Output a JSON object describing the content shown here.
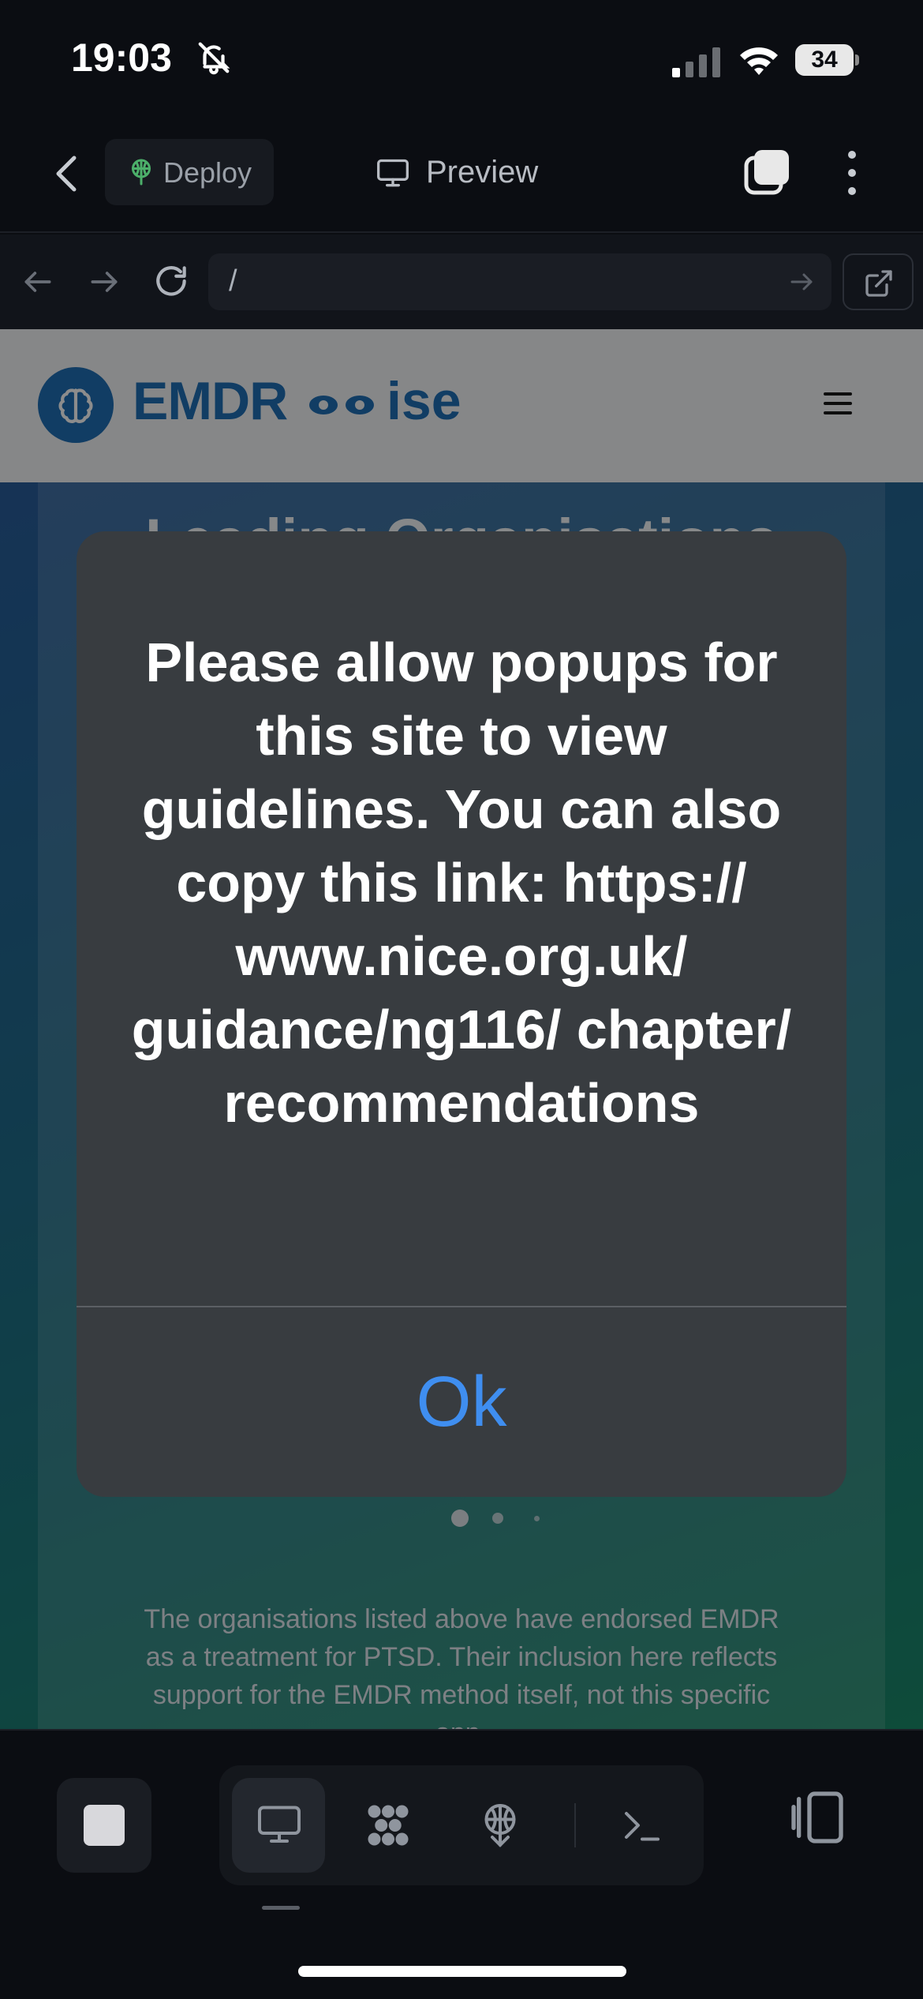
{
  "status_bar": {
    "time": "19:03",
    "battery_percent": "34",
    "icons": [
      "bell-slash-icon",
      "signal-icon",
      "wifi-icon",
      "battery-icon"
    ]
  },
  "app_toolbar": {
    "deploy_label": "Deploy",
    "preview_label": "Preview",
    "icons": [
      "chevron-left-icon",
      "deploy-icon",
      "monitor-icon",
      "tabs-icon",
      "more-vertical-icon"
    ]
  },
  "browser_bar": {
    "url": "/",
    "icons": [
      "arrow-left-icon",
      "arrow-right-icon",
      "reload-icon",
      "arrow-right-icon",
      "external-link-icon"
    ]
  },
  "site": {
    "brand_prefix": "EMDR",
    "brand_suffix": "ise",
    "brand_color": "#1f6fb6",
    "section_heading": "Leading Organisations",
    "footnote": "The organisations listed above have endorsed EMDR as a treatment for PTSD. Their inclusion here reflects support for the EMDR method itself, not this specific app.",
    "carousel": {
      "count": 3,
      "active_index": 0
    }
  },
  "alert": {
    "message": "Please allow popups for this site to view guidelines. You can also copy this link: https:// www.nice.org.uk/ guidance/ng116/ chapter/ recommendations",
    "ok_label": "Ok",
    "accent_color": "#3f8ef0"
  },
  "bottom_bar": {
    "tools": [
      "stop-icon",
      "monitor-icon",
      "components-icon",
      "deploy-icon",
      "terminal-icon",
      "panel-toggle-icon"
    ],
    "active_tool": "monitor-icon"
  }
}
